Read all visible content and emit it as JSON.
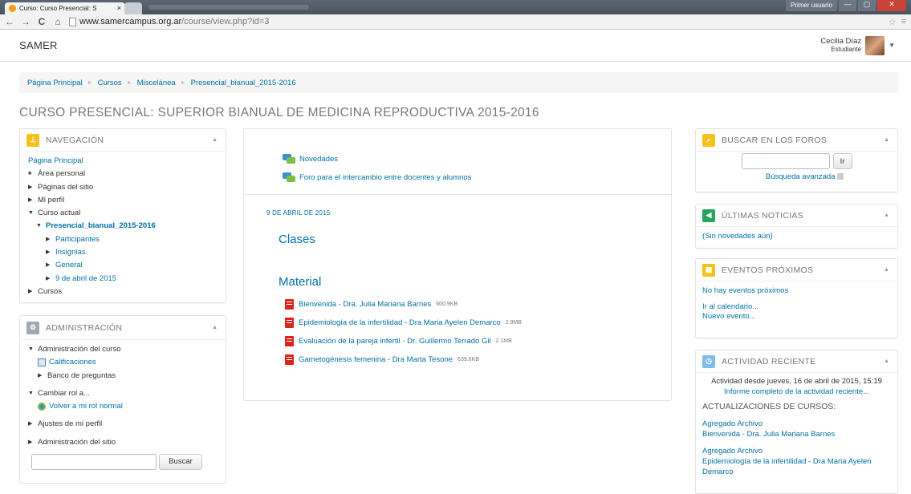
{
  "browser": {
    "tab_title": "Curso: Curso Presencial: S",
    "tab_close": "×",
    "profile_button": "Primer usuario",
    "win_min": "—",
    "win_max": "▢",
    "win_close": "✕",
    "url_host": "www.samercampus.org.ar",
    "url_path": "/course/view.php?id=3",
    "back": "←",
    "forward": "→",
    "reload": "C",
    "home": "⌂",
    "star": "☆",
    "menu": "≡"
  },
  "header": {
    "brand": "SAMER",
    "user_name": "Cecilia Díaz",
    "user_role": "Estudiante"
  },
  "breadcrumb": [
    "Página Principal",
    "Cursos",
    "Miscelánea",
    "Presencial_bianual_2015-2016"
  ],
  "course_title": "CURSO PRESENCIAL: SUPERIOR BIANUAL DE MEDICINA REPRODUCTIVA 2015-2016",
  "navigation": {
    "title": "NAVEGACIÓN",
    "home": "Página Principal",
    "personal": "Área personal",
    "site_pages": "Páginas del sitio",
    "profile": "Mi perfil",
    "current_course": "Curso actual",
    "course_short": "Presencial_bianual_2015-2016",
    "participants": "Participantes",
    "badges": "Insignias",
    "general": "General",
    "section_date": "9 de abril de 2015",
    "courses": "Cursos"
  },
  "administration": {
    "title": "ADMINISTRACIÓN",
    "course_admin": "Administración del curso",
    "grades": "Calificaciones",
    "question_bank": "Banco de preguntas",
    "switch_role": "Cambiar rol a...",
    "return_role": "Volver a mi rol normal",
    "profile_settings": "Ajustes de mi perfil",
    "site_admin": "Administración del sitio",
    "search_button": "Buscar"
  },
  "main": {
    "forums": [
      "Novedades",
      "Foro para el intercambio entre docentes y alumnos"
    ],
    "section_date": "9 DE ABRIL DE 2015",
    "topic_classes": "Clases",
    "topic_material": "Material",
    "files": [
      {
        "name": "Bienvenida - Dra. Julia Mariana Barnes",
        "size": "600.9KB"
      },
      {
        "name": "Epidemiología de la infertilidad - Dra Maria Ayelen Demarco",
        "size": "2.9MB"
      },
      {
        "name": "Evaluación de la pareja infértil - Dr. Guillermo Terrado Gil",
        "size": "2.1MB"
      },
      {
        "name": "Gametogénesis femenina - Dra Marta Tesone",
        "size": "639.6KB"
      }
    ]
  },
  "forum_search": {
    "title": "BUSCAR EN LOS FOROS",
    "go_button": "Ir",
    "advanced": "Búsqueda avanzada"
  },
  "news": {
    "title": "ÚLTIMAS NOTICIAS",
    "empty": "(Sin novedades aún)"
  },
  "events": {
    "title": "EVENTOS PRÓXIMOS",
    "empty": "No hay eventos próximos",
    "calendar": "Ir al calendario...",
    "new_event": "Nuevo evento..."
  },
  "activity": {
    "title": "ACTIVIDAD RECIENTE",
    "since": "Actividad desde jueves, 16 de abril de 2015, 15:19",
    "full_report": "Informe completo de la actividad reciente...",
    "updates_heading": "ACTUALIZACIONES DE CURSOS:",
    "items": [
      {
        "action": "Agregado Archivo",
        "item": "Bienvenida - Dra. Julia Mariana Barnes"
      },
      {
        "action": "Agregado Archivo",
        "item": "Epidemiología de la infertilidad - Dra Maria Ayelen Demarco"
      }
    ]
  },
  "colors": {
    "link": "#0070a8",
    "nav_icon": "#f5c11a",
    "admin_icon": "#a0a8b0",
    "search_icon": "#f5c11a",
    "news_icon": "#26a65b",
    "events_icon": "#f5c11a",
    "activity_icon": "#7fbce6",
    "pdf": "#d9251c"
  }
}
